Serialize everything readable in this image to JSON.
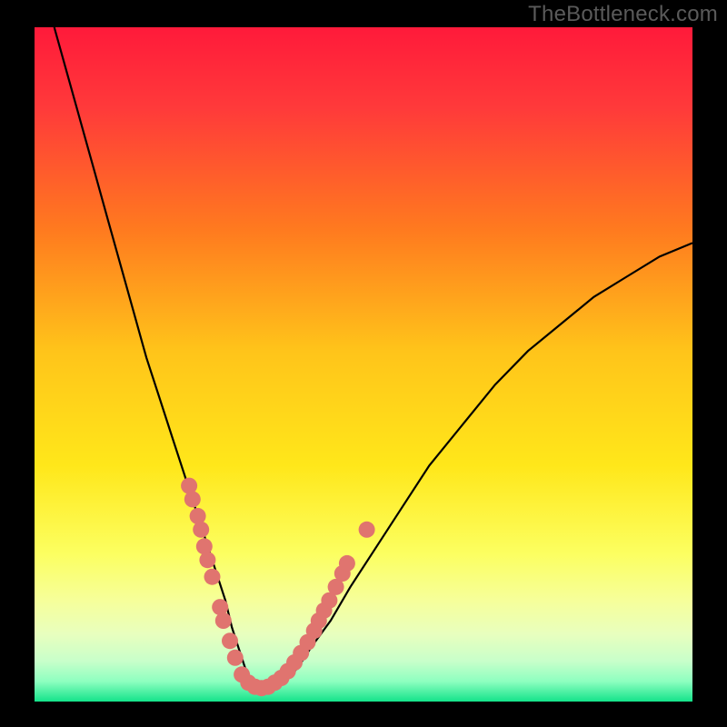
{
  "watermark": "TheBottleneck.com",
  "colors": {
    "frame": "#000000",
    "watermark_text": "#5a5a5a",
    "curve": "#000000",
    "dots": "#e0746f",
    "gradient_top": "#ff1a3a",
    "gradient_mid_upper": "#ff9b1a",
    "gradient_mid": "#ffe71a",
    "gradient_low1": "#fcff7a",
    "gradient_low2": "#f2ffb0",
    "gradient_low3": "#d6ffc7",
    "gradient_low4": "#a9ffce",
    "gradient_bottom": "#14e38a"
  },
  "chart_data": {
    "type": "line",
    "title": "",
    "xlabel": "",
    "ylabel": "",
    "xlim": [
      0,
      100
    ],
    "ylim": [
      0,
      100
    ],
    "series": [
      {
        "name": "bottleneck-curve",
        "x": [
          3,
          5,
          7,
          9,
          11,
          13,
          15,
          17,
          19,
          21,
          23,
          25,
          27,
          29,
          30,
          31,
          32,
          33,
          34,
          35,
          36,
          38,
          40,
          42,
          45,
          48,
          52,
          56,
          60,
          65,
          70,
          75,
          80,
          85,
          90,
          95,
          100
        ],
        "y": [
          100,
          93,
          86,
          79,
          72,
          65,
          58,
          51,
          45,
          39,
          33,
          27,
          21,
          15,
          11,
          8,
          5,
          3,
          2,
          2,
          2,
          3,
          5,
          8,
          12,
          17,
          23,
          29,
          35,
          41,
          47,
          52,
          56,
          60,
          63,
          66,
          68
        ]
      }
    ],
    "minimum_x": 34,
    "dot_clusters": [
      {
        "name": "left-branch-dots",
        "points": [
          {
            "x": 23.5,
            "y": 32.0
          },
          {
            "x": 24.0,
            "y": 30.0
          },
          {
            "x": 24.8,
            "y": 27.5
          },
          {
            "x": 25.3,
            "y": 25.5
          },
          {
            "x": 25.8,
            "y": 23.0
          },
          {
            "x": 26.3,
            "y": 21.0
          },
          {
            "x": 27.0,
            "y": 18.5
          },
          {
            "x": 28.2,
            "y": 14.0
          },
          {
            "x": 28.7,
            "y": 12.0
          },
          {
            "x": 29.7,
            "y": 9.0
          },
          {
            "x": 30.5,
            "y": 6.5
          }
        ]
      },
      {
        "name": "valley-dots",
        "points": [
          {
            "x": 31.5,
            "y": 4.0
          },
          {
            "x": 32.5,
            "y": 2.8
          },
          {
            "x": 33.5,
            "y": 2.2
          },
          {
            "x": 34.5,
            "y": 2.0
          },
          {
            "x": 35.5,
            "y": 2.2
          },
          {
            "x": 36.5,
            "y": 2.8
          },
          {
            "x": 37.5,
            "y": 3.5
          },
          {
            "x": 38.5,
            "y": 4.5
          }
        ]
      },
      {
        "name": "right-branch-dots",
        "points": [
          {
            "x": 39.5,
            "y": 5.8
          },
          {
            "x": 40.5,
            "y": 7.2
          },
          {
            "x": 41.5,
            "y": 8.8
          },
          {
            "x": 42.5,
            "y": 10.5
          },
          {
            "x": 43.2,
            "y": 12.0
          },
          {
            "x": 44.0,
            "y": 13.5
          },
          {
            "x": 44.8,
            "y": 15.0
          },
          {
            "x": 45.8,
            "y": 17.0
          },
          {
            "x": 46.8,
            "y": 19.0
          },
          {
            "x": 47.5,
            "y": 20.5
          },
          {
            "x": 50.5,
            "y": 25.5
          }
        ]
      }
    ],
    "gradient_bands_y": [
      {
        "y": 22,
        "label": "pale-yellow-start"
      },
      {
        "y": 12,
        "label": "light-green-start"
      },
      {
        "y": 3,
        "label": "green-bottom"
      }
    ]
  }
}
